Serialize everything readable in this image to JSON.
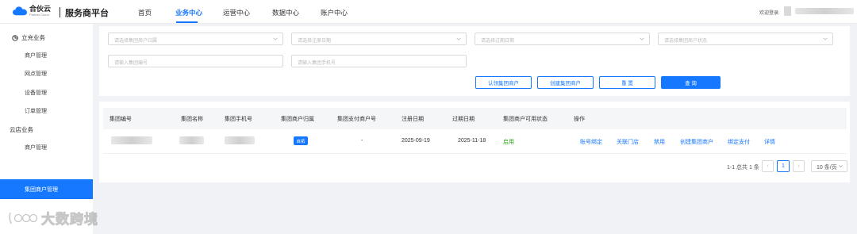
{
  "brand": {
    "logo_cn": "合伙云",
    "logo_en": "Partner Cloud",
    "title": "服务商平台"
  },
  "nav": {
    "items": [
      "首页",
      "业务中心",
      "运营中心",
      "数据中心",
      "账户中心"
    ],
    "active": "业务中心"
  },
  "user": {
    "welcome": "欢迎登录:"
  },
  "sidebar": {
    "group1": "立充业务",
    "group1_items": [
      "商户管理",
      "网点管理",
      "设备管理",
      "订单管理"
    ],
    "group2": "云店业务",
    "group2_items": [
      "商户管理",
      "集团商户管理"
    ]
  },
  "filters": {
    "f1": "请选择集团商户归属",
    "f2": "请选择注册日期",
    "f3": "请选择过期日期",
    "f4": "请选择集团商户状态",
    "f5": "请输入集团编号",
    "f6": "请输入集团手机号"
  },
  "buttons": {
    "claim": "认领集团商户",
    "create": "创建集团商户",
    "reset": "重 置",
    "query": "查 询"
  },
  "table": {
    "headers": [
      "集团编号",
      "集团名称",
      "集团手机号",
      "集团商户归属",
      "集团支付商户号",
      "注册日期",
      "过期日期",
      "集团商户可用状态",
      "操作"
    ],
    "row": {
      "owner_tag": "自拓",
      "pay_no": "-",
      "reg_date": "2025-09-19",
      "exp_date": "2025-11-18",
      "status": "启用",
      "actions": [
        "账号绑定",
        "关联门店",
        "禁用",
        "创建集团商户",
        "绑定支付",
        "详情"
      ]
    }
  },
  "pagination": {
    "total": "1-1 总共 1 条",
    "prev": "‹",
    "current": "1",
    "next": "›",
    "page_size": "10 条/页"
  },
  "watermark": {
    "text": "大数跨境"
  },
  "colors": {
    "accent": "#1677ff",
    "status_green": "#2aa515"
  }
}
